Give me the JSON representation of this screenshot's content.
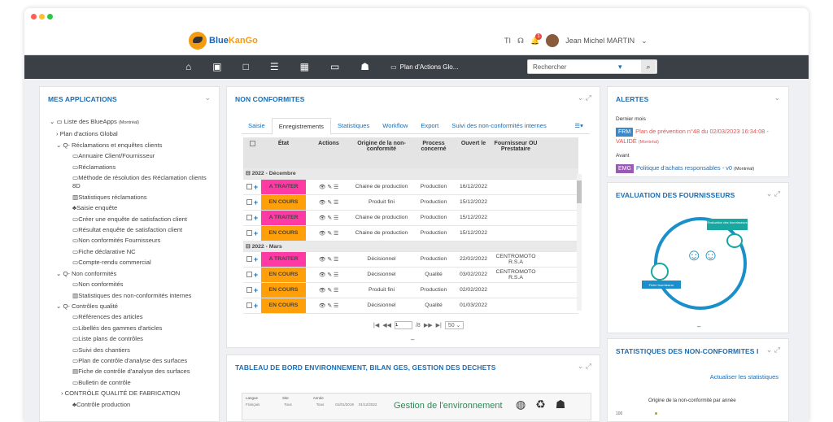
{
  "topbar": {
    "brand_blue": "Blue",
    "brand_orange": "KanGo",
    "text_icon": "TI",
    "notif_count": "1",
    "user": "Jean Michel MARTIN"
  },
  "nav": {
    "plan": "Plan d'Actions Glo...",
    "search_placeholder": "Rechercher"
  },
  "apps": {
    "title": "MES APPLICATIONS",
    "items": [
      "Liste des BlueApps",
      "(Montréal)",
      "Plan d'actions Global",
      "Q- Réclamations et enquêtes clients",
      "Annuaire Client/Fournisseur",
      "Réclamations",
      "Méthode de résolution des Réclamation clients",
      "8D",
      "Statistiques réclamations",
      "Saisie enquête",
      "Créer une enquête de satisfaction client",
      "Résultat enquête de satisfaction client",
      "Non conformités Fournisseurs",
      "Fiche déclarative NC",
      "Compte-rendu commercial",
      "Q- Non conformités",
      "Non conformités",
      "Statistiques des non-conformités internes",
      "Q- Contrôles qualité",
      "Références des articles",
      "Libellés des gammes d'articles",
      "Liste plans de contrôles",
      "Suivi des chantiers",
      "Plan de contrôle d'analyse des surfaces",
      "Fiche de contrôle d'analyse des surfaces",
      "Bulletin de contrôle",
      "CONTRÔLE QUALITÉ DE FABRICATION",
      "Contrôle production"
    ]
  },
  "nc": {
    "title": "NON CONFORMITES",
    "tabs": [
      "Saisie",
      "Enregistrements",
      "Statistiques",
      "Workflow",
      "Export",
      "Suivi des non-conformités internes"
    ],
    "headers": [
      "État",
      "Actions",
      "Origine de la non-conformité",
      "Process concerné",
      "Ouvert le",
      "Fournisseur OU Prestataire"
    ],
    "groups": [
      "2022 - Décembre",
      "2022 - Mars"
    ],
    "rows": [
      [
        "A TRAITER",
        "Chaine de production",
        "Production",
        "16/12/2022",
        ""
      ],
      [
        "EN COURS",
        "Produit fini",
        "Production",
        "15/12/2022",
        ""
      ],
      [
        "A TRAITER",
        "Chaine de production",
        "Production",
        "15/12/2022",
        ""
      ],
      [
        "EN COURS",
        "Chaine de production",
        "Production",
        "15/12/2022",
        ""
      ],
      [
        "A TRAITER",
        "Décisionnel",
        "Production",
        "22/02/2022",
        "CENTROMOTO R.S.A"
      ],
      [
        "EN COURS",
        "Décisionnel",
        "Qualité",
        "03/02/2022",
        "CENTROMOTO R.S.A"
      ],
      [
        "EN COURS",
        "Produit fini",
        "Production",
        "02/02/2022",
        ""
      ],
      [
        "EN COURS",
        "Décisionnel",
        "Qualité",
        "01/03/2022",
        ""
      ]
    ],
    "pager": {
      "page": "1",
      "of": "/8",
      "size": "50"
    }
  },
  "env": {
    "title": "TABLEAU DE BORD ENVIRONNEMENT, BILAN GES, GESTION DES DECHETS",
    "banner": "Gestion de l'environnement",
    "filters": [
      "Langue",
      "Site",
      "Année",
      "Français",
      "Tous",
      "Tous"
    ],
    "dates": [
      "01/01/2019",
      "01/12/2022"
    ]
  },
  "alerts": {
    "title": "ALERTES",
    "section1": "Dernier mois",
    "tag1": "FRM",
    "text1": "Plan de prévention n°48 du 02/03/2023 16:34:08 - VALIDÉ",
    "city1": "(Montréal)",
    "section2": "Avant",
    "tag2": "EMG",
    "text2": "Politique d'achats responsables - v0",
    "city2": "(Montréal)"
  },
  "eval": {
    "title": "EVALUATION DES FOURNISSEURS",
    "label1": "Evaluation des fournisseurs",
    "label2": "Fiche fournisseur",
    "dash": "–"
  },
  "stats": {
    "title": "STATISTIQUES DES NON-CONFORMITES I",
    "link": "Actualiser les statistiques",
    "chart_title": "Origine de la non-conformité par année",
    "y_tick": "100"
  },
  "colors": {
    "accent": "#1d6db3",
    "a_traiter": "#ff3aa5",
    "en_cours": "#ff9f0a",
    "navbar": "#3b4046"
  }
}
